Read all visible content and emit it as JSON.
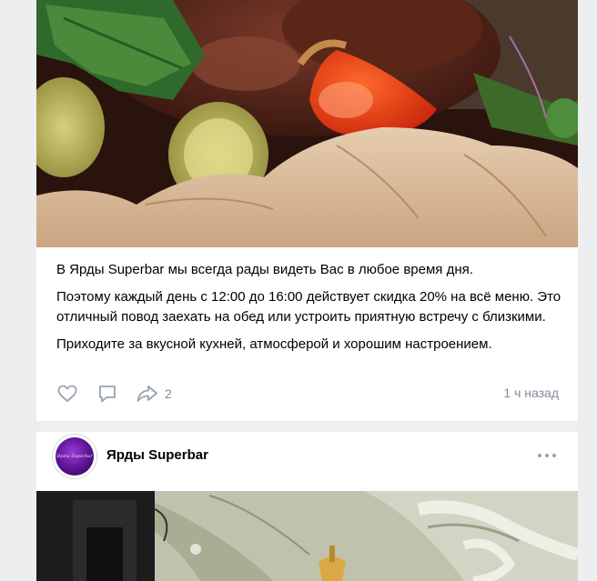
{
  "post1": {
    "text": [
      "В Ярды Superbar мы всегда рады видеть Вас в любое время дня.",
      "Поэтому каждый день с 12:00 до 16:00 действует скидка 20% на всё меню. Это отличный повод заехать на обед или устроить приятную встречу с близкими.",
      "Приходите за вкусной кухней, атмосферой и хорошим настроением."
    ],
    "actions": {
      "like_icon": "heart-icon",
      "comment_icon": "comment-icon",
      "share_icon": "share-icon",
      "share_count": "2"
    },
    "timestamp": "1 ч назад"
  },
  "post2": {
    "author": "Ярды Superbar",
    "avatar_text": "Ярды Superbar",
    "more_icon": "more-horizontal-icon"
  },
  "colors": {
    "background": "#edeef0",
    "card": "#ffffff",
    "muted_text": "#818c99",
    "icon": "#99a2ad",
    "avatar_purple": "#5a128f"
  }
}
